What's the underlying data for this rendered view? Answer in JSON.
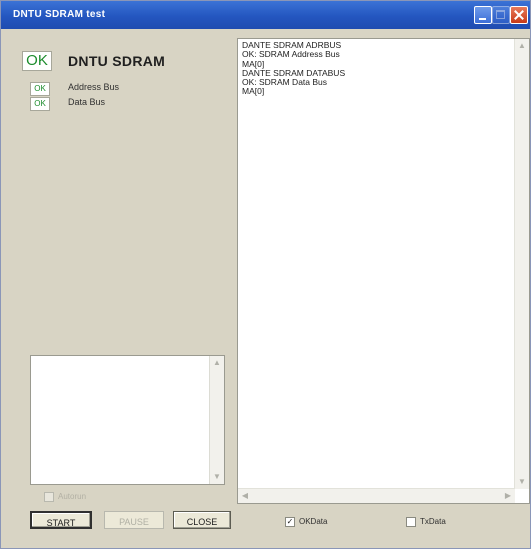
{
  "window": {
    "title": "DNTU SDRAM test"
  },
  "status": {
    "main_result": "OK",
    "main_title": "DNTU SDRAM",
    "tests": [
      {
        "result": "OK",
        "label": "Address Bus"
      },
      {
        "result": "OK",
        "label": "Data Bus"
      }
    ]
  },
  "log": {
    "lines": [
      "DANTE SDRAM ADRBUS",
      "OK: SDRAM Address Bus",
      "MA[0]",
      "DANTE SDRAM DATABUS",
      "OK: SDRAM Data Bus",
      "MA[0]"
    ]
  },
  "options": {
    "autorun": {
      "label": "Autorun",
      "checked": false,
      "enabled": false
    },
    "ok_data": {
      "label": "OKData",
      "checked": true,
      "enabled": true
    },
    "tx_data": {
      "label": "TxData",
      "checked": false,
      "enabled": true
    }
  },
  "buttons": {
    "start": "START",
    "pause": "PAUSE",
    "close": "CLOSE"
  },
  "icons": {
    "minimize": "minimize-icon",
    "maximize": "maximize-icon",
    "close": "close-icon",
    "check": "check-icon"
  }
}
